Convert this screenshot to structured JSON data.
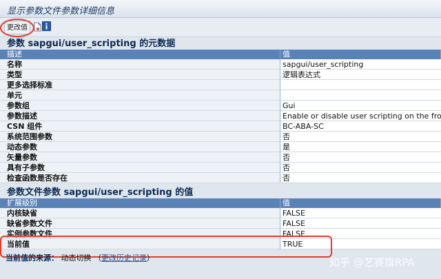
{
  "window": {
    "title": "显示参数文件参数详细信息"
  },
  "toolbar": {
    "change_value_label": "更改值"
  },
  "meta_section": {
    "title": "参数 sapgui/user_scripting 的元数据",
    "header": {
      "col1": "描述",
      "col2": "值"
    },
    "rows": [
      {
        "label": "名称",
        "value": "sapgui/user_scripting"
      },
      {
        "label": "类型",
        "value": "逻辑表达式"
      },
      {
        "label": "更多选择标准",
        "value": ""
      },
      {
        "label": "单元",
        "value": ""
      },
      {
        "label": "参数组",
        "value": "Gui"
      },
      {
        "label": "参数描述",
        "value": "Enable or disable user scripting on the fronte"
      },
      {
        "label": "CSN 组件",
        "value": "BC-ABA-SC"
      },
      {
        "label": "系统范围参数",
        "value": "否"
      },
      {
        "label": "动态参数",
        "value": "是"
      },
      {
        "label": "矢量参数",
        "value": "否"
      },
      {
        "label": "具有子参数",
        "value": "否"
      },
      {
        "label": "检查函数是否存在",
        "value": "否"
      }
    ]
  },
  "value_section": {
    "title": "参数文件参数 sapgui/user_scripting 的值",
    "header": {
      "col1": "扩展级别",
      "col2": "值"
    },
    "rows": [
      {
        "label": "内核缺省",
        "value": "FALSE"
      },
      {
        "label": "缺省参数文件",
        "value": "FALSE"
      },
      {
        "label": "实例参数文件",
        "value": "FALSE"
      },
      {
        "label": "当前值",
        "value": "TRUE"
      }
    ]
  },
  "source": {
    "label": "当前值的来源：",
    "value": "动态切换",
    "open_paren": "（",
    "link": "更改历史记录",
    "close_paren": "）"
  },
  "watermark": "知乎 @艺赛旗RPA",
  "colors": {
    "header_bg": "#5b82b6",
    "highlight": "#e23b2a",
    "title_text": "#1d3b66"
  },
  "icons": [
    "document-icon",
    "info-icon"
  ]
}
